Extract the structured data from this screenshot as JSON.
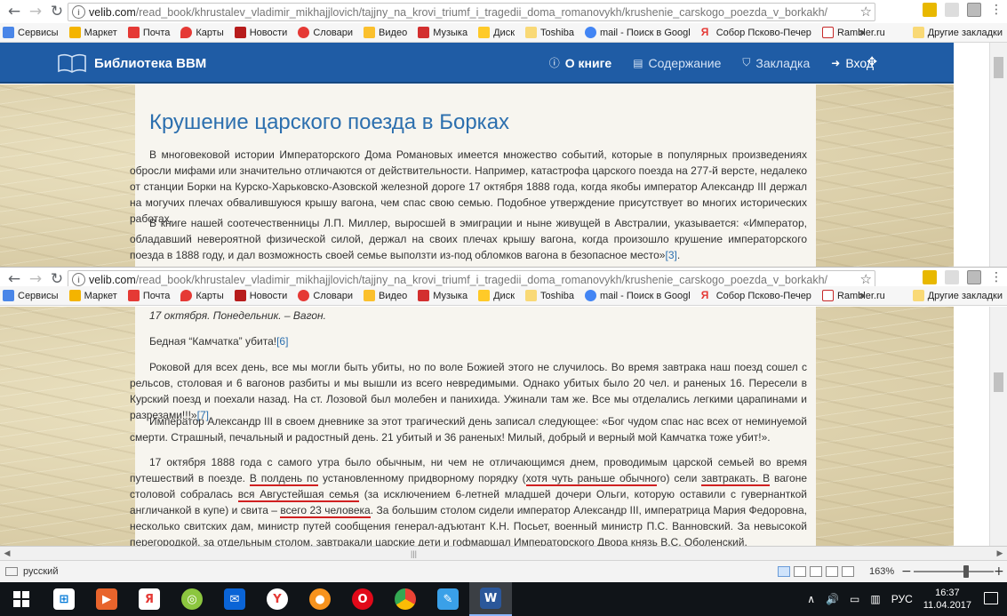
{
  "browser": {
    "url_host": "velib.com",
    "url_path": "/read_book/khrustalev_vladimir_mikhajjlovich/tajjny_na_krovi_triumf_i_tragedii_doma_romanovykh/krushenie_carskogo_poezda_v_borkakh/",
    "bookmarks": [
      "Сервисы",
      "Маркет",
      "Почта",
      "Карты",
      "Новости",
      "Словари",
      "Видео",
      "Музыка",
      "Диск",
      "Toshiba",
      "mail - Поиск в Googl",
      "Собор Псково-Печер",
      "Rambler.ru"
    ],
    "more": "»",
    "other_bookmarks": "Другие закладки"
  },
  "site": {
    "brand": "Библиотека ВВМ",
    "nav": [
      {
        "label": "О книге",
        "icon": "info-circle-icon"
      },
      {
        "label": "Содержание",
        "icon": "document-icon"
      },
      {
        "label": "Закладка",
        "icon": "bookmark-icon"
      },
      {
        "label": "Вход",
        "icon": "login-icon"
      }
    ]
  },
  "article_top": {
    "title": "Крушение царского поезда в Борках",
    "p1": "В многовековой истории Императорского Дома Романовых имеется множество событий, которые в популярных произведениях обросли мифами или значительно отличаются от действительности. Например, катастрофа царского поезда на 277-й версте, недалеко от станции Борки на Курско-Харьковско-Азовской железной дороге 17 октября 1888 года, когда якобы император Александр III держал на могучих плечах обвалившуюся крышу вагона, чем спас свою семью. Подобное утверждение присутствует во многих исторических работах.",
    "p2": "В книге нашей соотечественницы Л.П. Миллер, выросшей в эмиграции и ныне живущей в Австралии, указывается: «Император, обладавший невероятной физической силой, держал на своих плечах крышу вагона, когда произошло крушение императорского поезда в 1888 году, и дал возможность своей семье выползти из-под обломков вагона в безопасное место»",
    "p2_ref": "[3]",
    "p2_end": "."
  },
  "article_bottom": {
    "diary_line": "17 октября. Понедельник. – Вагон.",
    "p_kamchatka": "Бедная “Камчатка” убита!",
    "p_kamchatka_ref": "[6]",
    "p_rokovoy": "Роковой для всех день, все мы могли быть убиты, но по воле Божией этого не случилось. Во время завтрака наш поезд сошел с рельсов, столовая и 6 вагонов разбиты и мы вышли из всего невредимыми. Однако убитых было 20 чел. и раненых 16. Пересели в Курский поезд и поехали назад. На ст. Лозовой был молебен и панихида. Ужинали там же. Все мы отделались легкими царапинами и разрезами!!!»",
    "p_rokovoy_ref": "[7]",
    "p_emperor": "Император Александр III в своем дневнике за этот трагический день записал следующее: «Бог чудом спас нас всех от неминуемой смерти. Страшный, печальный и радостный день. 21 убитый и 36 раненых! Милый, добрый и верный мой Камчатка тоже убит!».",
    "p_last": {
      "t1": "17 октября 1888 года с самого утра было обычным, ни чем не отличающимся днем, проводимым царской семьей во время путешествий в поезде. ",
      "u1": "В полдень по",
      "t2": " установленному придворному порядку (",
      "u2": "хотя чуть раньше обычно",
      "t3": "го) сели ",
      "u3": "завтракать. В",
      "t4": " вагоне столовой собралась ",
      "u4": "вся Августейшая семья",
      "t5": " (за исключением 6-летней младшей дочери Ольги, которую оставили с гувернанткой англичанкой в купе) и свита – ",
      "u5": "всего 23 человека",
      "t6": ". За большим столом сидели император Александр III, императрица Мария Федоровна, несколько свитских дам, министр путей сообщения генерал-адъютант К.Н. Посьет, военный министр П.С. Ванновский. За невысокой перегородкой, за отдельным столом, завтракали царские дети и гофмаршал Императорского Двора князь В.С. Оболенский."
    }
  },
  "word_status": {
    "language": "русский",
    "zoom": "163%",
    "zoom_minus": "−",
    "zoom_plus": "+"
  },
  "taskbar": {
    "lang": "РУС",
    "time": "16:37",
    "date": "11.04.2017"
  }
}
